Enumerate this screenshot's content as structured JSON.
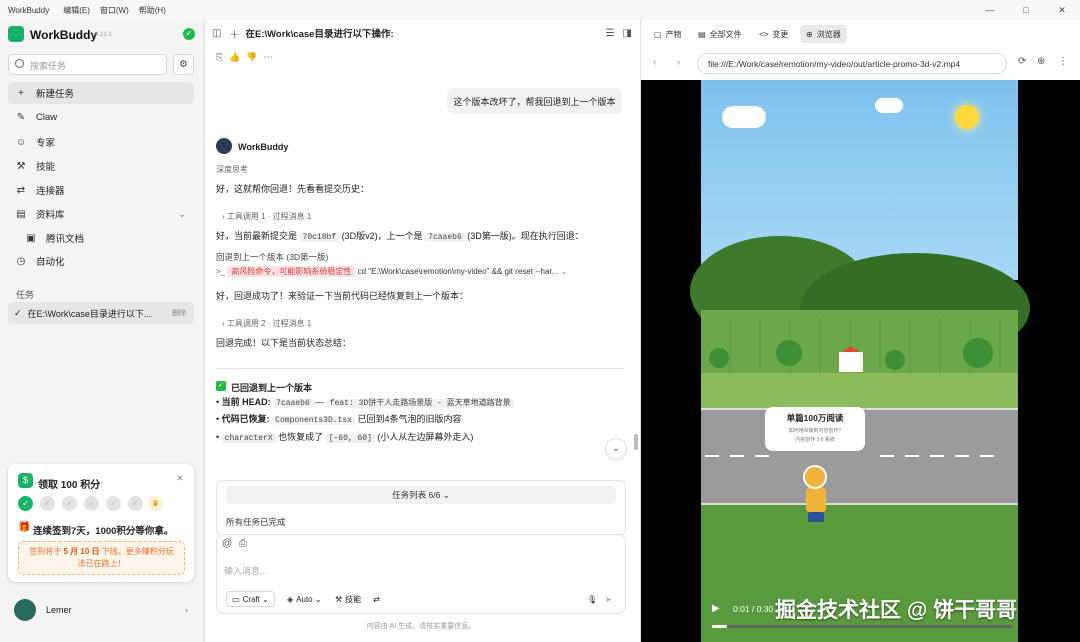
{
  "titlebar": {
    "app": "WorkBuddy",
    "menus": [
      "编辑(E)",
      "窗口(W)",
      "帮助(H)"
    ],
    "min": "—",
    "max": "□",
    "close": "✕"
  },
  "sidebar": {
    "brand": "WorkBuddy",
    "version": "v4.21.1",
    "search_placeholder": "搜索任务",
    "items": [
      {
        "label": "新建任务",
        "icon": "+"
      },
      {
        "label": "Claw",
        "icon": "✎"
      },
      {
        "label": "专家",
        "icon": "☺"
      },
      {
        "label": "技能",
        "icon": "⚒"
      },
      {
        "label": "连接器",
        "icon": "⇄"
      },
      {
        "label": "资料库",
        "icon": "▤"
      },
      {
        "label": "腾讯文档",
        "icon": "▣"
      },
      {
        "label": "自动化",
        "icon": "◷"
      }
    ],
    "section_tasks": "任务",
    "task": {
      "label": "在E:\\Work\\case目录进行以下...",
      "action": "删除"
    },
    "signin": {
      "title": "领取 100 积分",
      "streak": "连续签到7天，1000积分等你拿。",
      "promo_pre": "签到将于 ",
      "promo_date": "5 月 10 日",
      "promo_post": " 下线。更多赚积分玩",
      "promo_line2": "法已在路上！"
    },
    "user": {
      "name": "Lemer"
    }
  },
  "chat": {
    "title": "在E:\\Work\\case目录进行以下操作:",
    "user_message": "这个版本改坏了，帮我回退到上一个版本",
    "bot_name": "WorkBuddy",
    "thinking": "深度思考",
    "line1": "好，这就帮你回退！先看看提交历史：",
    "step1": "工具调用 1  ·  过程消息 1",
    "line2_a": "好，当前最新提交是 ",
    "commit_new": "70c18bf",
    "line2_b": " (3D版v2)，上一个是 ",
    "commit_old": "7caaeb6",
    "line2_c": " (3D第一版)。现在执行回退：",
    "rollback": "回退到上一个版本 (3D第一版)",
    "danger": "高风险命令，可能影响系统稳定性",
    "cmd": "cd \"E:\\Work\\case\\remotion\\my-video\" && git reset --har...",
    "line3": "好，回退成功了！来验证一下当前代码已经恢复到上一个版本：",
    "step2": "工具调用 2  ·  过程消息 1",
    "line4": "回退完成！以下是当前状态总结：",
    "summary_title": "已回退到上一个版本",
    "b1_label": "当前 HEAD:",
    "b1_code1": "7caaeb6",
    "b1_mid": " — ",
    "b1_code2": "feat: 3D饼干人走路场景版 - 蓝天草地道路背景",
    "b2_label": "代码已恢复:",
    "b2_code": "Components3D.tsx",
    "b2_text": " 已回到4条气泡的旧版内容",
    "b3_code": "characterX",
    "b3_mid": " 也恢复成了 ",
    "b3_code2": "[-60, 60]",
    "b3_text": " (小人从左边屏幕外走入)",
    "tasklist": "任务列表 6/6 ⌄",
    "tasks_done": "所有任务已完成",
    "input_placeholder": "输入消息...",
    "tools": [
      "Craft ⌄",
      "Auto ⌄",
      "技能"
    ],
    "disclaimer": "内容由 AI 生成，请核实重要信息。"
  },
  "right": {
    "tabs": [
      "产物",
      "全部文件",
      "变更",
      "浏览器"
    ],
    "url": "file:///E:/Work/case/remotion/my-video/out/article-promo-3d-v2.mp4",
    "video": {
      "bubble_title": "单篇100万阅读",
      "bubble_l1": "如何用AI做到内容创作?",
      "bubble_l2": "内容创作 3.6 系统",
      "time": "0:01 / 0:30",
      "progress": 0.05
    },
    "watermark": "掘金技术社区 @ 饼干哥哥"
  }
}
